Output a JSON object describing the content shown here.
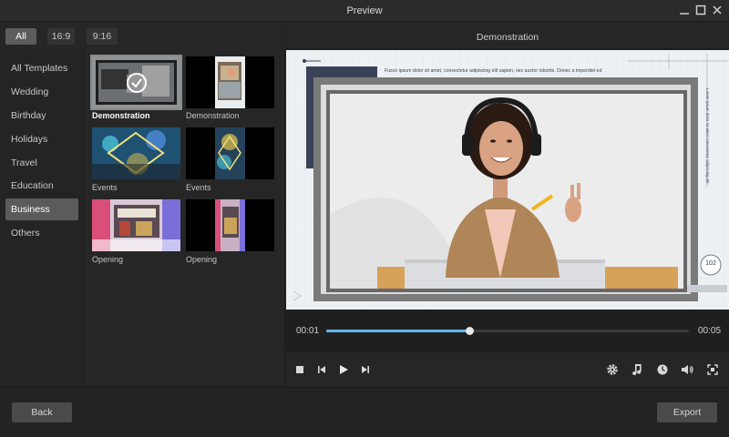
{
  "window": {
    "title": "Preview"
  },
  "aspect_filters": [
    {
      "label": "All",
      "active": true
    },
    {
      "label": "16:9",
      "active": false
    },
    {
      "label": "9:16",
      "active": false
    }
  ],
  "categories": [
    {
      "label": "All Templates"
    },
    {
      "label": "Wedding"
    },
    {
      "label": "Birthday"
    },
    {
      "label": "Holidays"
    },
    {
      "label": "Travel"
    },
    {
      "label": "Education"
    },
    {
      "label": "Business",
      "active": true
    },
    {
      "label": "Others"
    }
  ],
  "templates": [
    {
      "label": "Demonstration",
      "selected": true
    },
    {
      "label": "Demonstration"
    },
    {
      "label": "Events"
    },
    {
      "label": "Events"
    },
    {
      "label": "Opening"
    },
    {
      "label": "Opening"
    }
  ],
  "preview": {
    "title": "Demonstration",
    "caption_text": "Fusce ipsum dolor sit amet, consectetur adipiscing elit sapien, nec auctor lobortis. Donec a imperdiet ed",
    "side_text": "Lorem ipsum dolor sit amet consectetur adipiscing elit",
    "page_number": "102"
  },
  "playback": {
    "current_time": "00:01",
    "total_time": "00:05",
    "progress": 0.395
  },
  "footer": {
    "back_label": "Back",
    "export_label": "Export"
  },
  "icons": {
    "minimize": "minimize-icon",
    "maximize": "maximize-icon",
    "close": "close-icon",
    "stop": "stop-icon",
    "prev_frame": "previous-frame-icon",
    "play": "play-icon",
    "next_frame": "next-frame-icon",
    "settings": "gear-icon",
    "music": "music-note-icon",
    "clock": "clock-icon",
    "volume": "volume-icon",
    "fullscreen": "fullscreen-icon",
    "check": "checkmark-icon"
  },
  "colors": {
    "accent": "#5fb8ea",
    "active_bg": "#5b5b5b"
  }
}
